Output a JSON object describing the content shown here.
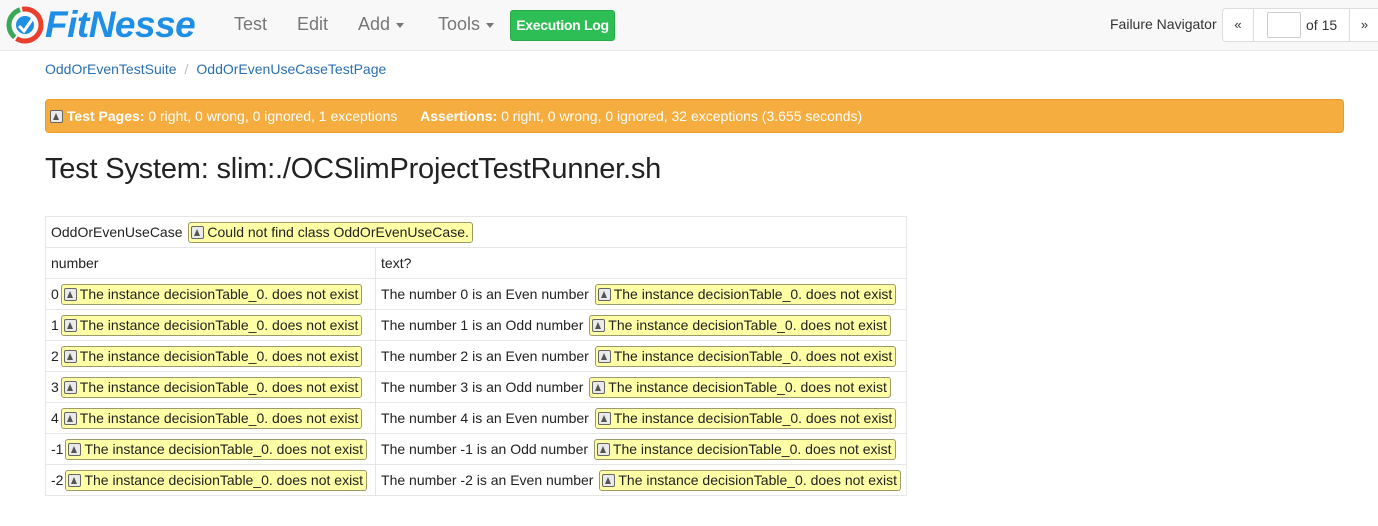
{
  "navbar": {
    "brand": "FitNesse",
    "items": [
      "Test",
      "Edit",
      "Add",
      "Tools"
    ],
    "execution_log": "Execution Log",
    "failure_navigator": {
      "label": "Failure Navigator",
      "prev": "«",
      "next": "»",
      "page_value": "",
      "of_text": "of 15"
    }
  },
  "breadcrumb": [
    "OddOrEvenTestSuite",
    "OddOrEvenUseCaseTestPage"
  ],
  "summary": {
    "test_pages_label": "Test Pages:",
    "test_pages_value": "0 right, 0 wrong, 0 ignored, 1 exceptions",
    "assertions_label": "Assertions:",
    "assertions_value": "0 right, 0 wrong, 0 ignored, 32 exceptions (3.655 seconds)"
  },
  "title": "Test System: slim:./OCSlimProjectTestRunner.sh",
  "table": {
    "class_name": "OddOrEvenUseCase",
    "class_error": "Could not find class OddOrEvenUseCase.",
    "headers": [
      "number",
      "text?"
    ],
    "rows": [
      {
        "number": "0",
        "number_error": "The instance decisionTable_0. does not exist",
        "text": "The number 0 is an Even number",
        "text_error": "The instance decisionTable_0. does not exist"
      },
      {
        "number": "1",
        "number_error": "The instance decisionTable_0. does not exist",
        "text": "The number 1 is an Odd number",
        "text_error": "The instance decisionTable_0. does not exist"
      },
      {
        "number": "2",
        "number_error": "The instance decisionTable_0. does not exist",
        "text": "The number 2 is an Even number",
        "text_error": "The instance decisionTable_0. does not exist"
      },
      {
        "number": "3",
        "number_error": "The instance decisionTable_0. does not exist",
        "text": "The number 3 is an Odd number",
        "text_error": "The instance decisionTable_0. does not exist"
      },
      {
        "number": "4",
        "number_error": "The instance decisionTable_0. does not exist",
        "text": "The number 4 is an Even number",
        "text_error": "The instance decisionTable_0. does not exist"
      },
      {
        "number": "-1",
        "number_error": "The instance decisionTable_0. does not exist",
        "text": "The number -1 is an Odd number",
        "text_error": "The instance decisionTable_0. does not exist"
      },
      {
        "number": "-2",
        "number_error": "The instance decisionTable_0. does not exist",
        "text": "The number -2 is an Even number",
        "text_error": "The instance decisionTable_0. does not exist"
      }
    ]
  },
  "colors": {
    "summary_bar": "#f6ad3f",
    "execution_log_button": "#2dbf55",
    "error_highlight": "#ffffa5",
    "link": "#2a6fb0"
  }
}
